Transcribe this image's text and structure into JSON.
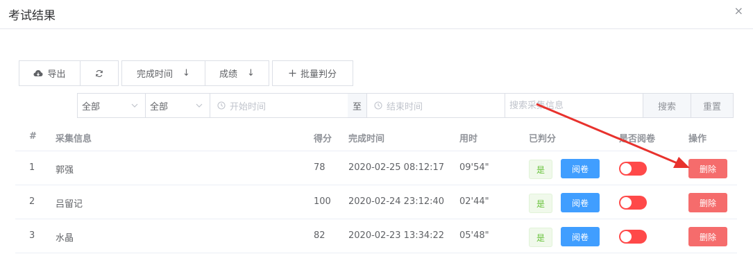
{
  "dialog": {
    "title": "考试结果",
    "close_glyph": "×"
  },
  "toolbar": {
    "export_label": "导出",
    "refresh_icon": "refresh-icon",
    "sort_time_label": "完成时间",
    "sort_score_label": "成绩",
    "sort_glyph": "↓",
    "batch_label": "批量判分"
  },
  "filters": {
    "select1_value": "全部",
    "select2_value": "全部",
    "start_placeholder": "开始时间",
    "range_separator": "至",
    "end_placeholder": "结束时间",
    "search_placeholder": "搜索采集信息",
    "search_button": "搜索",
    "reset_button": "重置"
  },
  "table": {
    "headers": [
      "#",
      "采集信息",
      "得分",
      "完成时间",
      "用时",
      "已判分",
      "是否阅卷",
      "操作"
    ],
    "rows": [
      {
        "index": "1",
        "name": "郭强",
        "score": "78",
        "time": "2020-02-25 08:12:17",
        "duration": "09'54\"",
        "graded": "是",
        "review_label": "阅卷",
        "reviewed": false,
        "delete_label": "删除"
      },
      {
        "index": "2",
        "name": "吕留记",
        "score": "100",
        "time": "2020-02-24 23:12:40",
        "duration": "02'44\"",
        "graded": "是",
        "review_label": "阅卷",
        "reviewed": false,
        "delete_label": "删除"
      },
      {
        "index": "3",
        "name": "水晶",
        "score": "82",
        "time": "2020-02-23 13:34:22",
        "duration": "05'48\"",
        "graded": "是",
        "review_label": "阅卷",
        "reviewed": false,
        "delete_label": "删除"
      }
    ]
  },
  "colors": {
    "primary": "#409eff",
    "danger": "#f56c6c",
    "switch_off": "#ff4949",
    "success": "#67c23a",
    "annotation_arrow": "#e8322d"
  }
}
